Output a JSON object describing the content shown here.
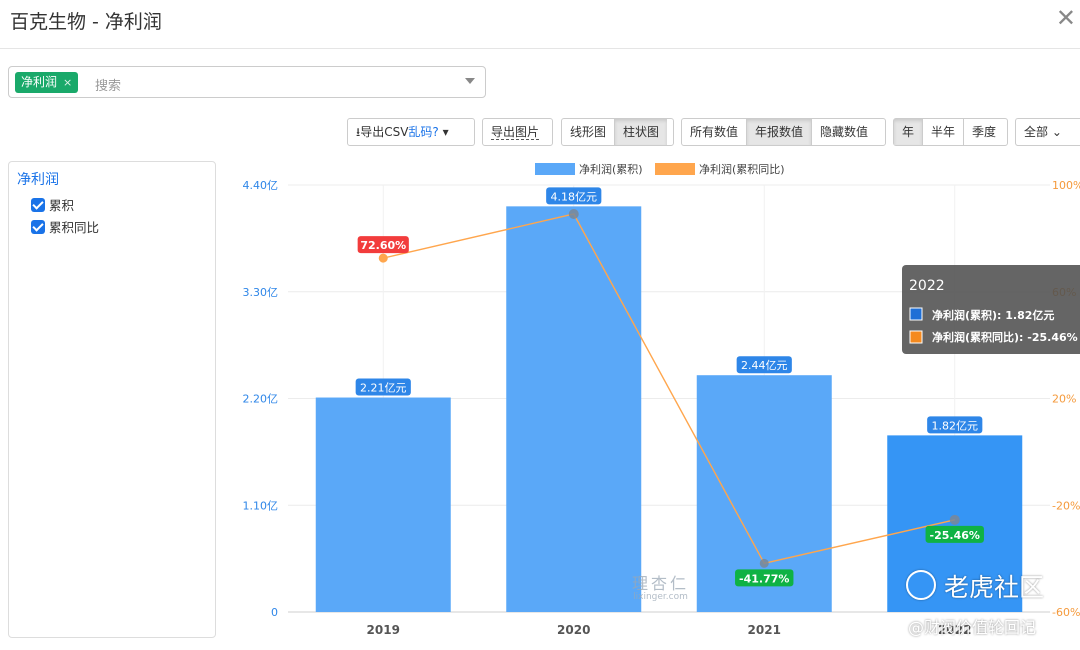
{
  "header": {
    "title": "百克生物 - 净利润",
    "close": "✕"
  },
  "selector": {
    "tag": "净利润",
    "tag_remove": "×",
    "placeholder": "搜索"
  },
  "toolbar": {
    "export_csv": "导出CSV",
    "garbled": "乱码?",
    "export_image": "导出图片",
    "line_chart": "线形图",
    "bar_chart": "柱状图",
    "all_values": "所有数值",
    "annual_values": "年报数值",
    "hide_values": "隐藏数值",
    "year": "年",
    "half_year": "半年",
    "quarter": "季度",
    "range": "全部"
  },
  "sidebar": {
    "title": "净利润",
    "items": [
      {
        "label": "累积",
        "checked": true
      },
      {
        "label": "累积同比",
        "checked": true
      }
    ]
  },
  "colors": {
    "bar": "#5aa8f8",
    "bar_highlight": "#3595f5",
    "line": "#ffa64d",
    "green": "#0fb244",
    "red": "#f23c3c",
    "label_blue": "#2e86e8"
  },
  "chart_data": {
    "type": "bar",
    "categories": [
      "2019",
      "2020",
      "2021",
      "2022"
    ],
    "series": [
      {
        "name": "净利润(累积)",
        "type": "bar",
        "values": [
          2.21,
          4.18,
          2.44,
          1.82
        ],
        "labels": [
          "2.21亿元",
          "4.18亿元",
          "2.44亿元",
          "1.82亿元"
        ]
      },
      {
        "name": "净利润(累积同比)",
        "type": "line",
        "values": [
          72.6,
          89.14,
          -41.77,
          -25.46
        ],
        "labels": [
          "72.60%",
          "",
          "-41.77%",
          "-25.46%"
        ]
      }
    ],
    "left_axis": {
      "ticks": [
        "0",
        "1.10亿",
        "2.20亿",
        "3.30亿",
        "4.40亿"
      ],
      "values": [
        0,
        1.1,
        2.2,
        3.3,
        4.4
      ],
      "ylim": [
        0,
        4.4
      ]
    },
    "right_axis": {
      "ticks": [
        "-60%",
        "-20%",
        "20%",
        "60%",
        "100%"
      ],
      "values": [
        -60,
        -20,
        20,
        60,
        100
      ],
      "ylim": [
        -60,
        100
      ]
    },
    "legend_position": "top",
    "tooltip": {
      "title": "2022",
      "rows": [
        "净利润(累积): 1.82亿元",
        "净利润(累积同比): -25.46%"
      ]
    }
  },
  "watermarks": {
    "lixinger_cn": "理杏仁",
    "lixinger_url": "lixinger.com",
    "tiger": "老虎社区",
    "author": "@财阀价值轮回记"
  }
}
